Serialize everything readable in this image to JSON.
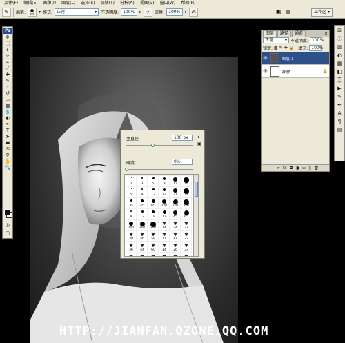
{
  "menubar": {
    "items": [
      "文件(F)",
      "编辑(E)",
      "图像(I)",
      "图层(L)",
      "选择(S)",
      "滤镜(T)",
      "分析(A)",
      "视图(V)",
      "窗口(W)",
      "帮助(H)"
    ]
  },
  "options": {
    "brush_label": "画笔:",
    "brush_size": "100",
    "mode_label": "模式:",
    "mode_value": "正常",
    "opacity_label": "不透明度:",
    "opacity_value": "100%",
    "flow_label": "流量:",
    "flow_value": "100%",
    "workspace": "工作区 ▾"
  },
  "layers_panel": {
    "tabs": [
      "图层",
      "路径",
      "通道"
    ],
    "blend_mode": "正常",
    "opacity_label": "不透明度:",
    "opacity_value": "100%",
    "lock_label": "锁定:",
    "fill_label": "填充:",
    "fill_value": "100%",
    "layers": [
      {
        "name": "图层 1",
        "selected": true
      },
      {
        "name": "背景",
        "selected": false,
        "locked": true
      }
    ]
  },
  "brush_popup": {
    "diameter_label": "主直径",
    "diameter_value": "100 px",
    "diameter_fraction": 0.4,
    "hardness_label": "硬度:",
    "hardness_value": "0%",
    "hardness_fraction": 0.0,
    "presets": [
      {
        "shape": "dot",
        "d": 1,
        "n": "1"
      },
      {
        "shape": "dot",
        "d": 2,
        "n": "3"
      },
      {
        "shape": "dot",
        "d": 3,
        "n": "5"
      },
      {
        "shape": "dot",
        "d": 4,
        "n": "9"
      },
      {
        "shape": "dot",
        "d": 6,
        "n": "13"
      },
      {
        "shape": "dot",
        "d": 8,
        "n": "19"
      },
      {
        "shape": "dot",
        "d": 1,
        "n": "5"
      },
      {
        "shape": "dot",
        "d": 2,
        "n": "9"
      },
      {
        "shape": "dot",
        "d": 3,
        "n": "13"
      },
      {
        "shape": "dot",
        "d": 4,
        "n": "17"
      },
      {
        "shape": "dot",
        "d": 6,
        "n": "21"
      },
      {
        "shape": "dot",
        "d": 8,
        "n": "27"
      },
      {
        "shape": "dot",
        "d": 3,
        "n": "35"
      },
      {
        "shape": "dot",
        "d": 4,
        "n": "45"
      },
      {
        "shape": "dot",
        "d": 5,
        "n": "65"
      },
      {
        "shape": "dot",
        "d": 6,
        "n": "100"
      },
      {
        "shape": "dot",
        "d": 7,
        "n": "200"
      },
      {
        "shape": "dot",
        "d": 8,
        "n": "300"
      },
      {
        "shape": "dot",
        "d": 2,
        "n": "9"
      },
      {
        "shape": "dot",
        "d": 3,
        "n": "13"
      },
      {
        "shape": "dot",
        "d": 4,
        "n": "19"
      },
      {
        "shape": "dot",
        "d": 5,
        "n": "17"
      },
      {
        "shape": "dot",
        "d": 6,
        "n": "45"
      },
      {
        "shape": "dot",
        "d": 7,
        "n": "65"
      },
      {
        "shape": "dot",
        "d": 6,
        "n": "100"
      },
      {
        "shape": "dot",
        "d": 7,
        "n": "200"
      },
      {
        "shape": "dot",
        "d": 8,
        "n": "300"
      },
      {
        "shape": "star",
        "n": "14"
      },
      {
        "shape": "star",
        "n": "24"
      },
      {
        "shape": "star",
        "n": "27"
      },
      {
        "shape": "star",
        "n": "39"
      },
      {
        "shape": "star",
        "n": "46"
      },
      {
        "shape": "star",
        "n": "59"
      },
      {
        "shape": "star",
        "n": "11"
      },
      {
        "shape": "star",
        "n": "17"
      },
      {
        "shape": "star",
        "n": "23"
      },
      {
        "shape": "star",
        "n": "36"
      },
      {
        "shape": "star",
        "n": "44"
      },
      {
        "shape": "star",
        "n": "60"
      },
      {
        "shape": "star",
        "n": "14"
      },
      {
        "shape": "star",
        "n": "26"
      },
      {
        "shape": "star",
        "n": "33"
      },
      {
        "shape": "star",
        "n": ""
      },
      {
        "shape": "star",
        "n": ""
      },
      {
        "shape": "star",
        "n": ""
      },
      {
        "shape": "star",
        "n": ""
      },
      {
        "shape": "star",
        "n": ""
      },
      {
        "shape": "star",
        "n": ""
      }
    ]
  },
  "toolbox": {
    "badge": "Ps",
    "tools": [
      "move-tool",
      "marquee-tool",
      "lasso-tool",
      "magic-wand-tool",
      "crop-tool",
      "slice-tool",
      "healing-brush-tool",
      "brush-tool",
      "clone-stamp-tool",
      "history-brush-tool",
      "eraser-tool",
      "gradient-tool",
      "blur-tool",
      "dodge-tool",
      "pen-tool",
      "type-tool",
      "path-select-tool",
      "shape-tool",
      "notes-tool",
      "eyedropper-tool",
      "hand-tool",
      "zoom-tool"
    ]
  },
  "watermark": "HTTP://JIANFAN.QZONE.QQ.COM"
}
